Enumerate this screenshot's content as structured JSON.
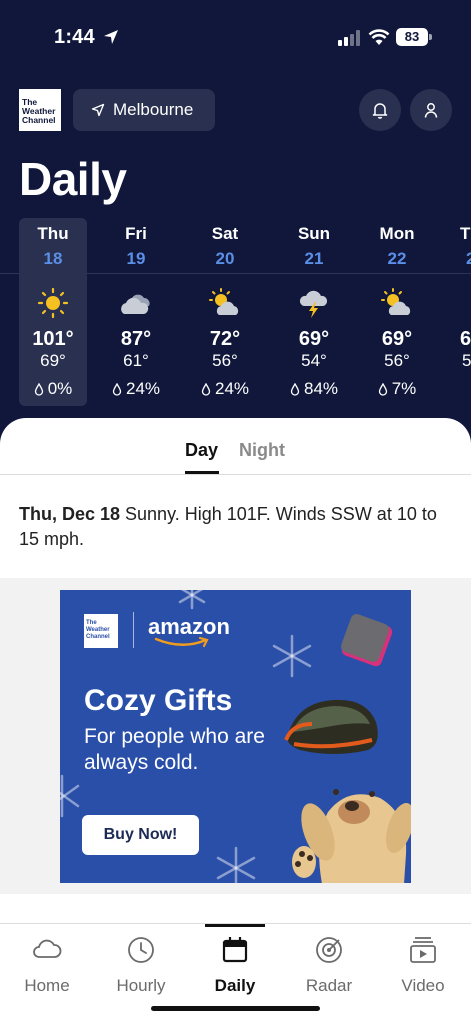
{
  "status_bar": {
    "time": "1:44",
    "battery": "83"
  },
  "header": {
    "logo_text": "The Weather Channel",
    "location": "Melbourne",
    "title": "Daily"
  },
  "days": [
    {
      "name": "Thu",
      "date": "18",
      "hi": "101°",
      "lo": "69°",
      "precip": "0%",
      "icon": "sun-icon"
    },
    {
      "name": "Fri",
      "date": "19",
      "hi": "87°",
      "lo": "61°",
      "precip": "24%",
      "icon": "cloudy-icon"
    },
    {
      "name": "Sat",
      "date": "20",
      "hi": "72°",
      "lo": "56°",
      "precip": "24%",
      "icon": "partly-cloudy-icon"
    },
    {
      "name": "Sun",
      "date": "21",
      "hi": "69°",
      "lo": "54°",
      "precip": "84%",
      "icon": "thunderstorm-icon"
    },
    {
      "name": "Mon",
      "date": "22",
      "hi": "69°",
      "lo": "56°",
      "precip": "7%",
      "icon": "partly-cloudy-icon"
    },
    {
      "name": "T",
      "date": "2",
      "hi": "6",
      "lo": "5",
      "precip": "",
      "icon": "sun-icon"
    }
  ],
  "toggle": {
    "day": "Day",
    "night": "Night"
  },
  "summary": {
    "date": "Thu, Dec 18",
    "text": " Sunny. High 101F. Winds SSW at 10 to 15 mph."
  },
  "ad": {
    "brand": "amazon",
    "logo_text": "The Weather Channel",
    "headline": "Cozy Gifts",
    "subline": "For people who are always cold.",
    "cta": "Buy Now!"
  },
  "nav": {
    "items": [
      {
        "label": "Home",
        "icon": "home-icon"
      },
      {
        "label": "Hourly",
        "icon": "clock-icon"
      },
      {
        "label": "Daily",
        "icon": "calendar-icon"
      },
      {
        "label": "Radar",
        "icon": "radar-icon"
      },
      {
        "label": "Video",
        "icon": "video-icon"
      }
    ]
  },
  "colors": {
    "background": "#10173a",
    "pill": "#2a3150",
    "date_blue": "#5b8ee6",
    "sun": "#f5c022",
    "ad_blue": "#2a4fa8"
  }
}
